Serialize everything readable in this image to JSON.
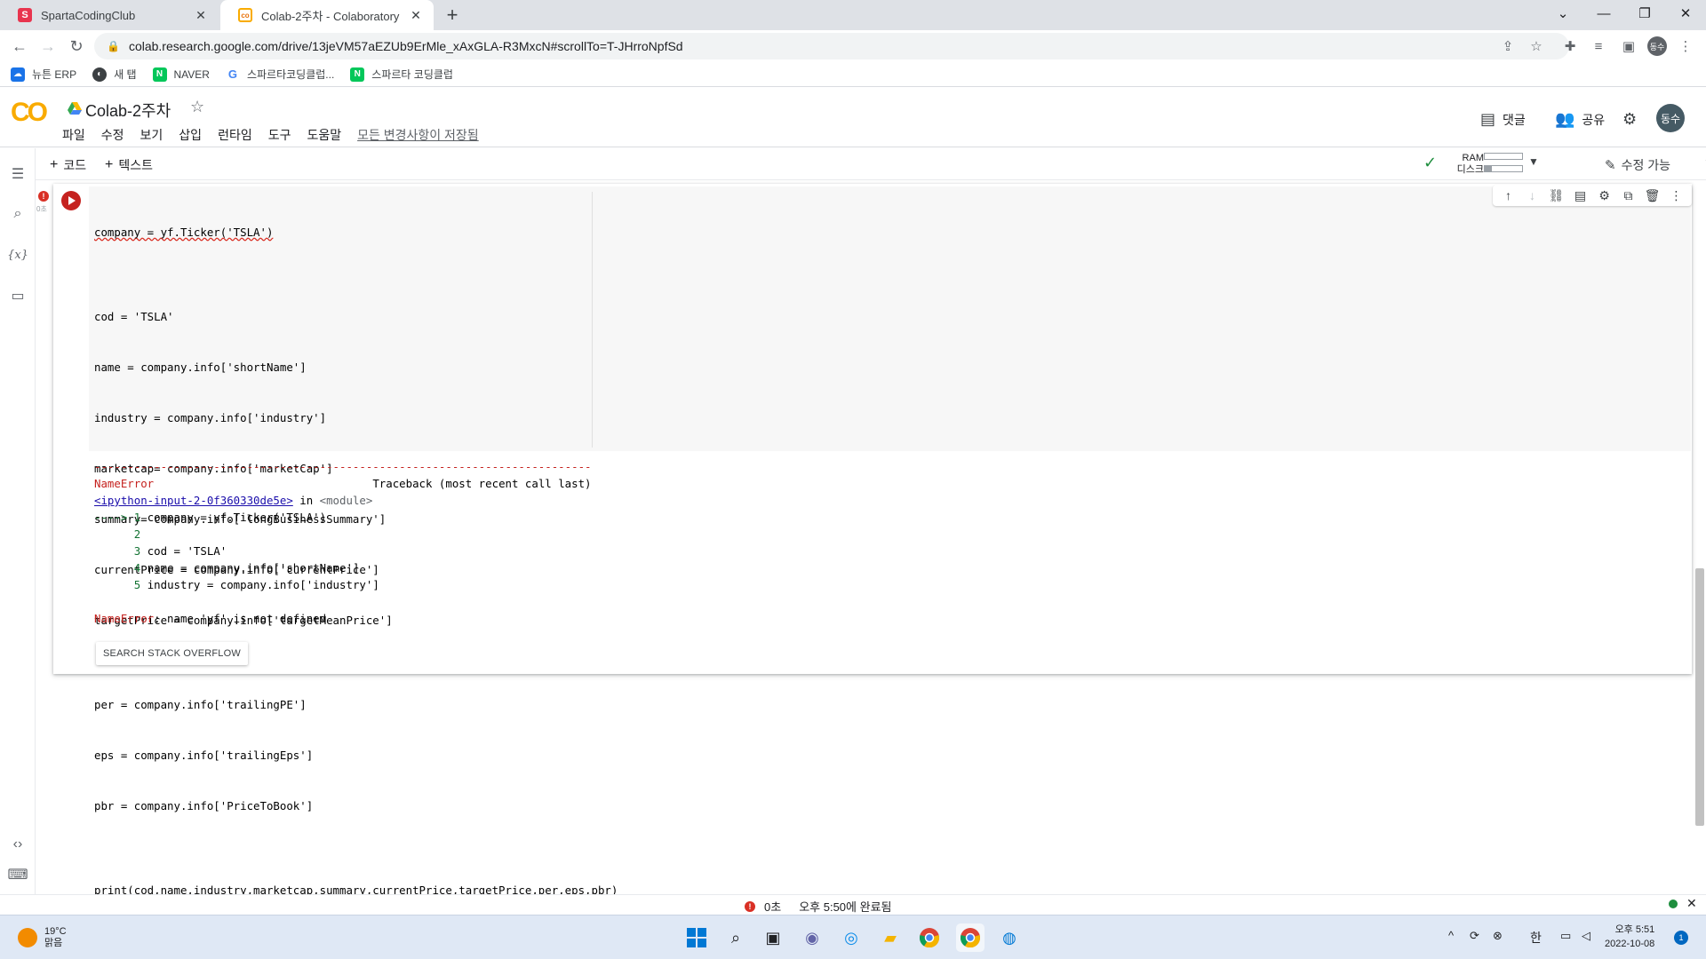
{
  "browser": {
    "tabs": [
      {
        "label": "SpartaCodingClub",
        "favicon": "sparta-favicon-icon",
        "active": false
      },
      {
        "label": "Colab-2주차 - Colaboratory",
        "favicon": "colab-favicon-icon",
        "active": true
      }
    ],
    "url": "colab.research.google.com/drive/13jeVM57aEZUb9ErMle_xAxGLA-R3MxcN#scrollTo=T-JHrroNpfSd",
    "profile_initials": "동수",
    "bookmarks": [
      {
        "label": "뉴튼 ERP",
        "icon": "cloud-icon"
      },
      {
        "label": "새 탭",
        "icon": "globe-icon"
      },
      {
        "label": "NAVER",
        "icon": "naver-icon"
      },
      {
        "label": "스파르타코딩클럽...",
        "icon": "google-icon"
      },
      {
        "label": "스파르타 코딩클럽",
        "icon": "naver-icon"
      }
    ]
  },
  "colab": {
    "logo": "CO",
    "title": "Colab-2주차",
    "menu": [
      "파일",
      "수정",
      "보기",
      "삽입",
      "런타임",
      "도구",
      "도움말"
    ],
    "save_status": "모든 변경사항이 저장됨",
    "comment_label": "댓글",
    "share_label": "공유",
    "user_initials": "동수",
    "add_code": "코드",
    "add_text": "텍스트",
    "ram_label": "RAM",
    "disk_label": "디스크",
    "ram_usage": 0.0,
    "disk_usage": 0.2,
    "edit_mode": "수정 가능"
  },
  "cell": {
    "exec_time": "0초",
    "code_lines": [
      "company = yf.Ticker('TSLA')",
      "",
      "cod = 'TSLA'",
      "name = company.info['shortName']",
      "industry = company.info['industry']",
      "marketcap= company.info['marketCap']",
      "summary= company.info['longBusinessSummary']",
      "currentPrice = company.info['currentPrice']",
      "targetPrice = company.info['targetMeanPrice']",
      "",
      "per = company.info['trailingPE']",
      "eps = company.info['trailingEps']",
      "pbr = company.info['PriceToBook']",
      "",
      "print(cod,name,industry,marketcap,summary,currentPrice,targetPrice,per,eps,pbr)"
    ],
    "output": {
      "separator": "---------------------------------------------------------------------------",
      "error_name": "NameError",
      "traceback_header": "Traceback (most recent call last)",
      "input_link": "<ipython-input-2-0f360330de5e>",
      "in_word": " in ",
      "module": "<module>",
      "arrow_line_prefix": "----> 1 ",
      "arrow_line_code": "company = yf.Ticker('TSLA')",
      "context_lines": [
        {
          "num": "      2",
          "code": ""
        },
        {
          "num": "      3",
          "code": "cod = 'TSLA'"
        },
        {
          "num": "      4",
          "code": "name = company.info['shortName']"
        },
        {
          "num": "      5",
          "code": "industry = company.info['industry']"
        }
      ],
      "error_message": ": name 'yf' is not defined"
    },
    "search_button": "SEARCH STACK OVERFLOW"
  },
  "status": {
    "time": "0초",
    "message": "오후 5:50에 완료됨"
  },
  "taskbar": {
    "weather_temp": "19°C",
    "weather_desc": "맑음",
    "ime": "한",
    "clock_time": "오후 5:51",
    "clock_date": "2022-10-08",
    "notifications": "1"
  }
}
